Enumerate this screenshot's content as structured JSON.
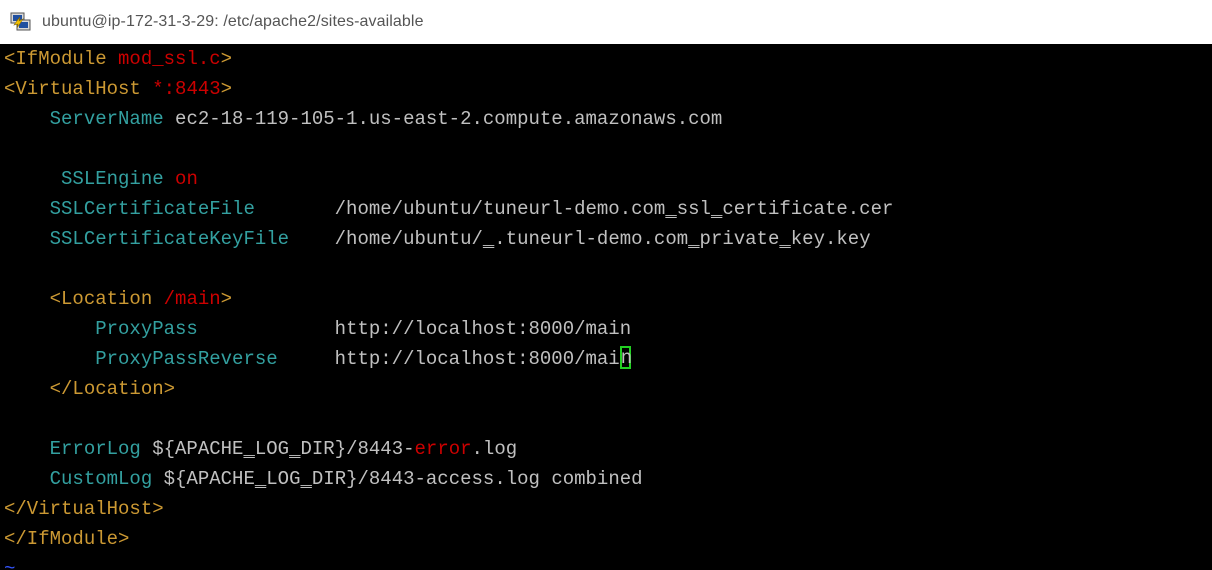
{
  "window": {
    "title": "ubuntu@ip-172-31-3-29: /etc/apache2/sites-available"
  },
  "terminal": {
    "lines": [
      {
        "segments": [
          {
            "t": "<IfModule ",
            "c": "tag"
          },
          {
            "t": "mod_ssl.c",
            "c": "red",
            "u": [
              [
                3,
                4
              ]
            ]
          },
          {
            "t": ">",
            "c": "tag"
          }
        ]
      },
      {
        "segments": [
          {
            "t": "<VirtualHost ",
            "c": "tag"
          },
          {
            "t": "*:8443",
            "c": "red"
          },
          {
            "t": ">",
            "c": "tag"
          }
        ]
      },
      {
        "segments": [
          {
            "t": "    ServerName",
            "c": "dir"
          },
          {
            "t": " ec2-18-119-105-1.us-east-2.compute.amazonaws.com",
            "c": "txt"
          }
        ]
      },
      {
        "segments": [
          {
            "t": "",
            "c": "txt"
          }
        ]
      },
      {
        "segments": [
          {
            "t": "     SSLEngine",
            "c": "dir"
          },
          {
            "t": " on",
            "c": "red"
          }
        ]
      },
      {
        "segments": [
          {
            "t": "    SSLCertificateFile",
            "c": "dir"
          },
          {
            "t": "       /home/ubuntu/tuneurl-demo.com",
            "c": "txt"
          },
          {
            "t": "_",
            "c": "txt"
          },
          {
            "t": "ssl",
            "c": "txt"
          },
          {
            "t": "_",
            "c": "txt"
          },
          {
            "t": "certificate.cer",
            "c": "txt"
          }
        ]
      },
      {
        "segments": [
          {
            "t": "    SSLCertificateKeyFile",
            "c": "dir"
          },
          {
            "t": "    /home/ubuntu/",
            "c": "txt"
          },
          {
            "t": "_",
            "c": "txt"
          },
          {
            "t": ".tuneurl-demo.com",
            "c": "txt"
          },
          {
            "t": "_",
            "c": "txt"
          },
          {
            "t": "private",
            "c": "txt"
          },
          {
            "t": "_",
            "c": "txt"
          },
          {
            "t": "key.key",
            "c": "txt"
          }
        ]
      },
      {
        "segments": [
          {
            "t": "",
            "c": "txt"
          }
        ]
      },
      {
        "segments": [
          {
            "t": "    <Location ",
            "c": "tag"
          },
          {
            "t": "/main",
            "c": "red"
          },
          {
            "t": ">",
            "c": "tag"
          }
        ]
      },
      {
        "segments": [
          {
            "t": "        ProxyPass",
            "c": "dir"
          },
          {
            "t": "            http://localhost:8000/main",
            "c": "txt"
          }
        ]
      },
      {
        "segments": [
          {
            "t": "        ProxyPassReverse",
            "c": "dir"
          },
          {
            "t": "     http://localhost:8000/mai",
            "c": "txt"
          },
          {
            "t": "n",
            "c": "cursor"
          }
        ]
      },
      {
        "segments": [
          {
            "t": "    </Location>",
            "c": "tag"
          }
        ]
      },
      {
        "segments": [
          {
            "t": "",
            "c": "txt"
          }
        ]
      },
      {
        "segments": [
          {
            "t": "    ErrorLog",
            "c": "dir"
          },
          {
            "t": " ${APACHE",
            "c": "txt"
          },
          {
            "t": "_",
            "c": "txt"
          },
          {
            "t": "LOG",
            "c": "txt"
          },
          {
            "t": "_",
            "c": "txt"
          },
          {
            "t": "DIR}/8443-",
            "c": "txt"
          },
          {
            "t": "error",
            "c": "red"
          },
          {
            "t": ".log",
            "c": "txt"
          }
        ]
      },
      {
        "segments": [
          {
            "t": "    CustomLog",
            "c": "dir"
          },
          {
            "t": " ${APACHE",
            "c": "txt"
          },
          {
            "t": "_",
            "c": "txt"
          },
          {
            "t": "LOG",
            "c": "txt"
          },
          {
            "t": "_",
            "c": "txt"
          },
          {
            "t": "DIR}/8443-access.log combined",
            "c": "txt"
          }
        ]
      },
      {
        "segments": [
          {
            "t": "</VirtualHost>",
            "c": "tag"
          }
        ]
      },
      {
        "segments": [
          {
            "t": "</IfModule>",
            "c": "tag"
          }
        ]
      },
      {
        "segments": [
          {
            "t": "~",
            "c": "tilde"
          }
        ]
      }
    ]
  },
  "colors": {
    "background": "#000000",
    "tag": "#cc9933",
    "value": "#cc0000",
    "directive": "#33a0a0",
    "text": "#c0c0c0",
    "cursor": "#22d022"
  },
  "icons": {
    "app": "putty-icon"
  }
}
